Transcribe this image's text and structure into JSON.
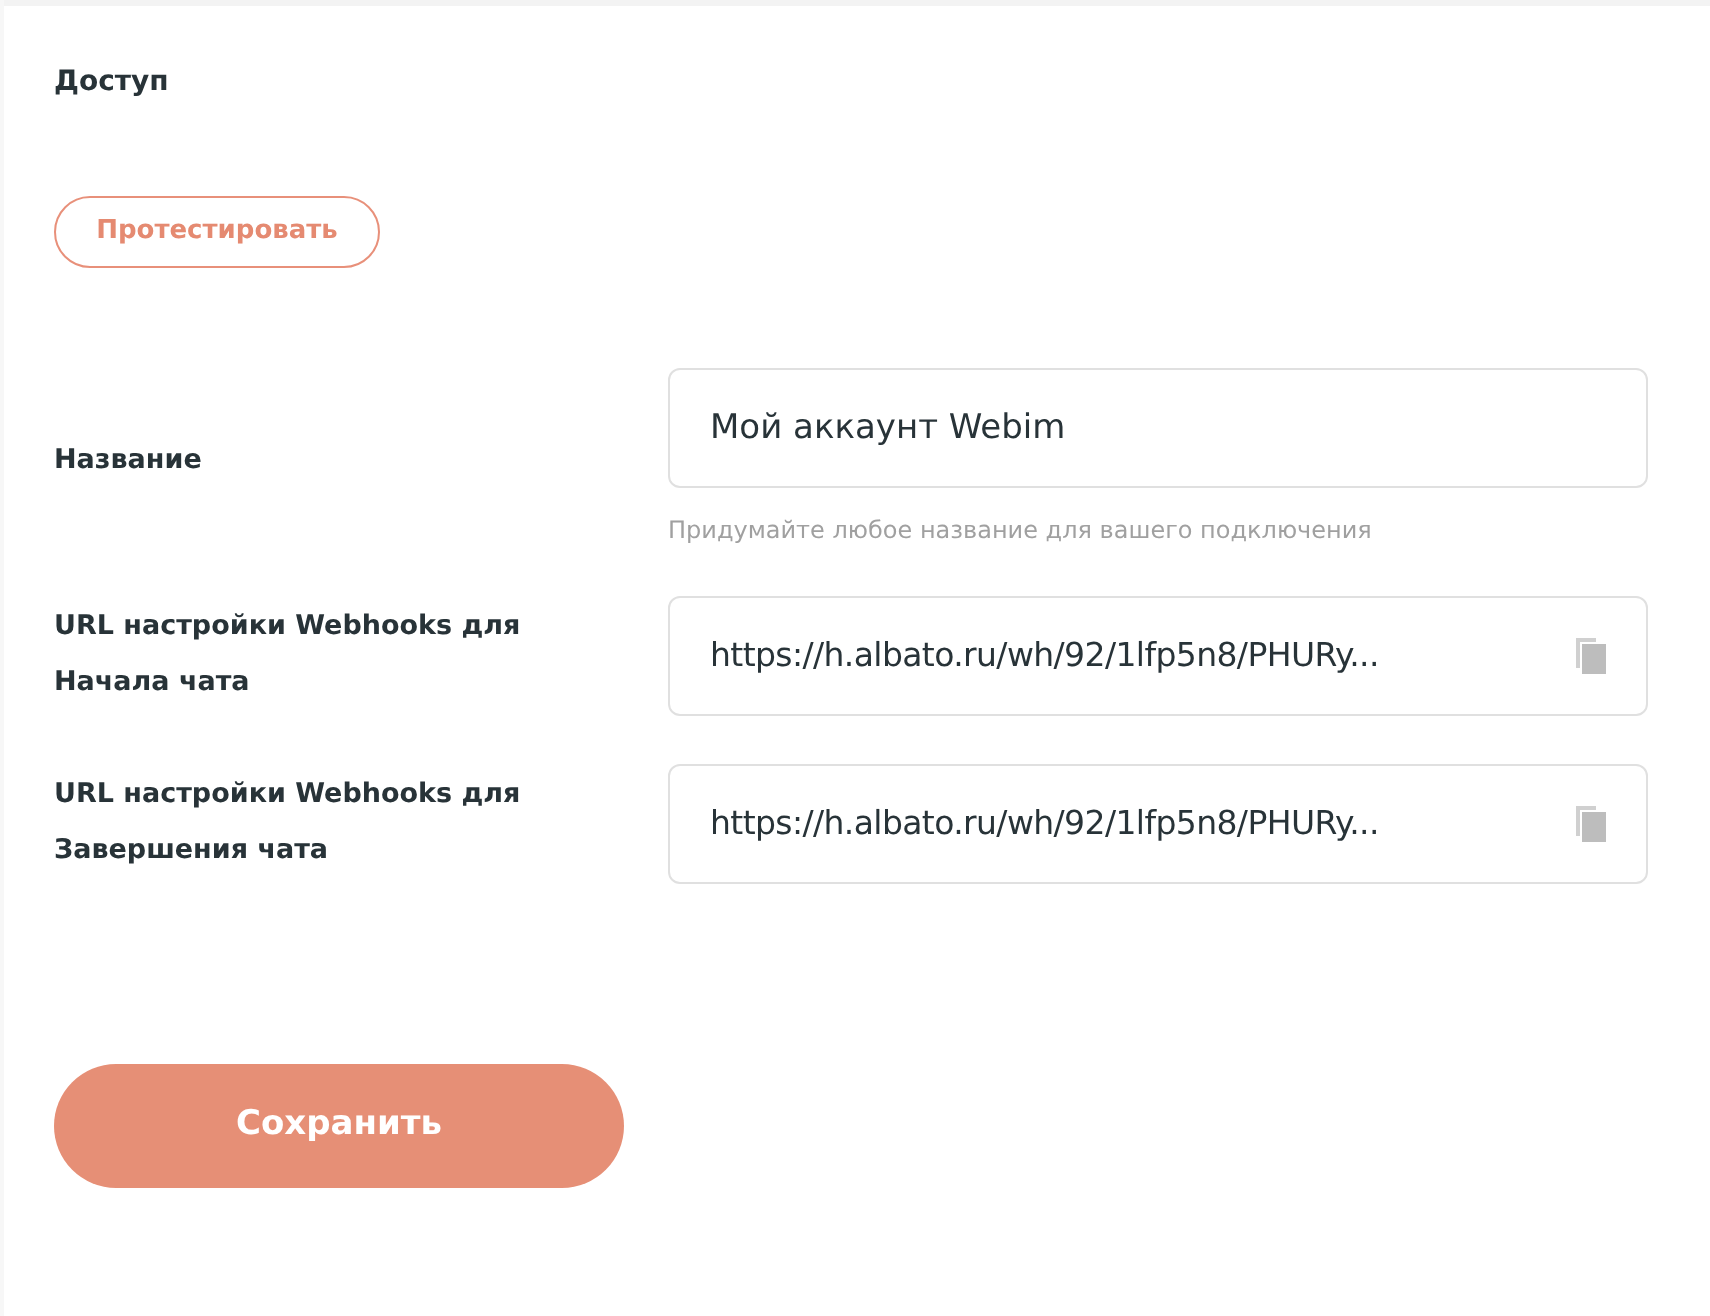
{
  "section": {
    "title": "Доступ"
  },
  "test_button": {
    "label": "Протестировать"
  },
  "fields": [
    {
      "kind": "text",
      "label": "Название",
      "value": "Мой аккаунт Webim",
      "hint": "Придумайте любое название для вашего подключения"
    },
    {
      "kind": "url",
      "label": "URL настройки Webhooks для Начала чата",
      "value": "https://h.albato.ru/wh/92/1lfp5n8/PHURy..."
    },
    {
      "kind": "url",
      "label": "URL настройки Webhooks для Завершения чата",
      "value": "https://h.albato.ru/wh/92/1lfp5n8/PHURy..."
    }
  ],
  "save_button": {
    "label": "Сохранить"
  }
}
